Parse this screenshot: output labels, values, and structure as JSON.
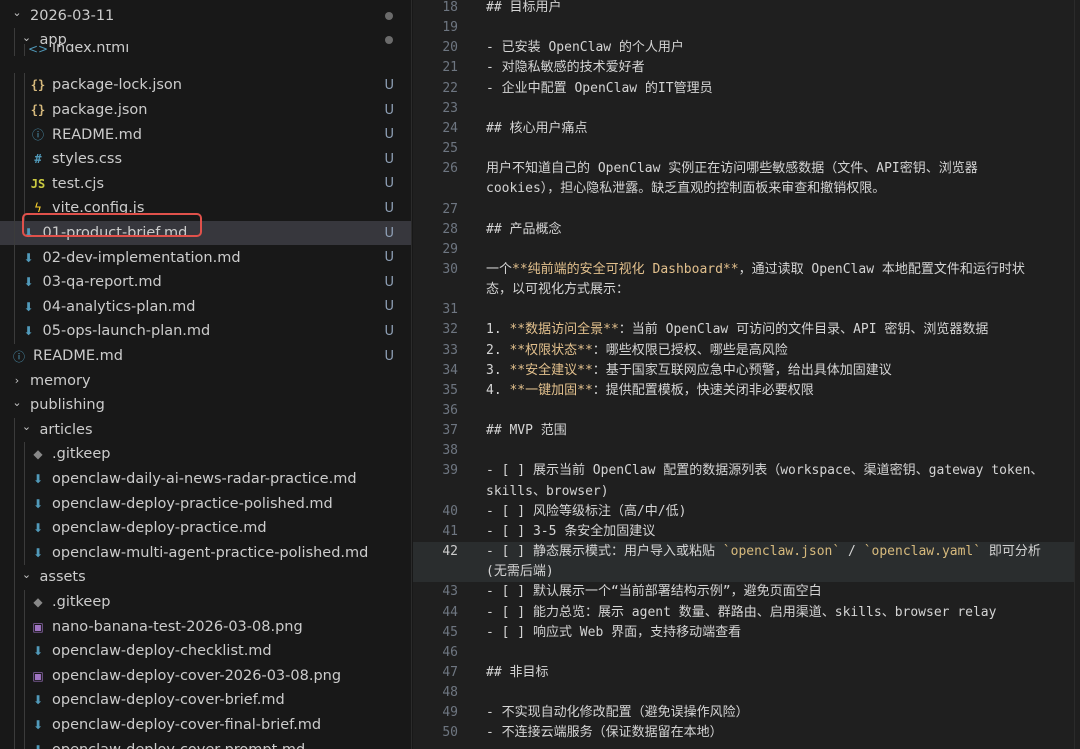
{
  "sidebar": {
    "rows": [
      {
        "label": "2026-03-11",
        "kind": "folder-open",
        "icon": "chevron-down-icon",
        "depth": 0,
        "status": "dot"
      },
      {
        "label": "app",
        "kind": "folder-open",
        "icon": "chevron-down-icon",
        "depth": 1,
        "status": "dot"
      },
      {
        "label": "index.html",
        "kind": "file",
        "icon": "html-icon",
        "depth": 2,
        "status": "",
        "partial": true
      },
      {
        "label": "package-lock.json",
        "kind": "file",
        "icon": "json-icon",
        "depth": 2,
        "status": "U"
      },
      {
        "label": "package.json",
        "kind": "file",
        "icon": "json-icon",
        "depth": 2,
        "status": "U"
      },
      {
        "label": "README.md",
        "kind": "file",
        "icon": "info-icon",
        "depth": 2,
        "status": "U"
      },
      {
        "label": "styles.css",
        "kind": "file",
        "icon": "css-icon",
        "depth": 2,
        "status": "U"
      },
      {
        "label": "test.cjs",
        "kind": "file",
        "icon": "js-icon",
        "depth": 2,
        "status": "U"
      },
      {
        "label": "vite.config.js",
        "kind": "file",
        "icon": "vite-icon",
        "depth": 2,
        "status": "U"
      },
      {
        "label": "01-product-brief.md",
        "kind": "file",
        "icon": "markdown-icon",
        "depth": 1,
        "status": "U",
        "selected": true
      },
      {
        "label": "02-dev-implementation.md",
        "kind": "file",
        "icon": "markdown-icon",
        "depth": 1,
        "status": "U"
      },
      {
        "label": "03-qa-report.md",
        "kind": "file",
        "icon": "markdown-icon",
        "depth": 1,
        "status": "U"
      },
      {
        "label": "04-analytics-plan.md",
        "kind": "file",
        "icon": "markdown-icon",
        "depth": 1,
        "status": "U"
      },
      {
        "label": "05-ops-launch-plan.md",
        "kind": "file",
        "icon": "markdown-icon",
        "depth": 1,
        "status": "U"
      },
      {
        "label": "README.md",
        "kind": "file",
        "icon": "info-icon",
        "depth": 0,
        "status": "U"
      },
      {
        "label": "memory",
        "kind": "folder-closed",
        "icon": "chevron-right-icon",
        "depth": 0,
        "status": ""
      },
      {
        "label": "publishing",
        "kind": "folder-open",
        "icon": "chevron-down-icon",
        "depth": 0,
        "status": ""
      },
      {
        "label": "articles",
        "kind": "folder-open",
        "icon": "chevron-down-icon",
        "depth": 1,
        "status": ""
      },
      {
        "label": ".gitkeep",
        "kind": "file",
        "icon": "gitkeep-icon",
        "depth": 2,
        "status": ""
      },
      {
        "label": "openclaw-daily-ai-news-radar-practice.md",
        "kind": "file",
        "icon": "markdown-icon",
        "depth": 2,
        "status": ""
      },
      {
        "label": "openclaw-deploy-practice-polished.md",
        "kind": "file",
        "icon": "markdown-icon",
        "depth": 2,
        "status": ""
      },
      {
        "label": "openclaw-deploy-practice.md",
        "kind": "file",
        "icon": "markdown-icon",
        "depth": 2,
        "status": ""
      },
      {
        "label": "openclaw-multi-agent-practice-polished.md",
        "kind": "file",
        "icon": "markdown-icon",
        "depth": 2,
        "status": ""
      },
      {
        "label": "assets",
        "kind": "folder-open",
        "icon": "chevron-down-icon",
        "depth": 1,
        "status": ""
      },
      {
        "label": ".gitkeep",
        "kind": "file",
        "icon": "gitkeep-icon",
        "depth": 2,
        "status": ""
      },
      {
        "label": "nano-banana-test-2026-03-08.png",
        "kind": "file",
        "icon": "image-icon",
        "depth": 2,
        "status": ""
      },
      {
        "label": "openclaw-deploy-checklist.md",
        "kind": "file",
        "icon": "markdown-icon",
        "depth": 2,
        "status": ""
      },
      {
        "label": "openclaw-deploy-cover-2026-03-08.png",
        "kind": "file",
        "icon": "image-icon",
        "depth": 2,
        "status": ""
      },
      {
        "label": "openclaw-deploy-cover-brief.md",
        "kind": "file",
        "icon": "markdown-icon",
        "depth": 2,
        "status": ""
      },
      {
        "label": "openclaw-deploy-cover-final-brief.md",
        "kind": "file",
        "icon": "markdown-icon",
        "depth": 2,
        "status": ""
      },
      {
        "label": "openclaw-deploy-cover-prompt.md",
        "kind": "file",
        "icon": "markdown-icon",
        "depth": 2,
        "status": ""
      }
    ]
  },
  "editor": {
    "active_line": "42",
    "lines": [
      {
        "n": "18",
        "text": "## 目标用户"
      },
      {
        "n": "19",
        "text": ""
      },
      {
        "n": "20",
        "text": "- 已安装 OpenClaw 的个人用户"
      },
      {
        "n": "21",
        "text": "- 对隐私敏感的技术爱好者"
      },
      {
        "n": "22",
        "text": "- 企业中配置 OpenClaw 的IT管理员"
      },
      {
        "n": "23",
        "text": ""
      },
      {
        "n": "24",
        "text": "## 核心用户痛点"
      },
      {
        "n": "25",
        "text": ""
      },
      {
        "n": "26",
        "text": "用户不知道自己的 OpenClaw 实例正在访问哪些敏感数据（文件、API密钥、浏览器"
      },
      {
        "n": "",
        "text": "cookies），担心隐私泄露。缺乏直观的控制面板来审查和撤销权限。"
      },
      {
        "n": "27",
        "text": ""
      },
      {
        "n": "28",
        "text": "## 产品概念"
      },
      {
        "n": "29",
        "text": ""
      },
      {
        "n": "30",
        "pre": "一个",
        "bold": "**纯前端的安全可视化 Dashboard**",
        "post": "，通过读取 OpenClaw 本地配置文件和运行时状"
      },
      {
        "n": "",
        "text": "态，以可视化方式展示："
      },
      {
        "n": "31",
        "text": ""
      },
      {
        "n": "32",
        "pre": "1. ",
        "bold": "**数据访问全景**",
        "post": "：当前 OpenClaw 可访问的文件目录、API 密钥、浏览器数据"
      },
      {
        "n": "33",
        "pre": "2. ",
        "bold": "**权限状态**",
        "post": "：哪些权限已授权、哪些是高风险"
      },
      {
        "n": "34",
        "pre": "3. ",
        "bold": "**安全建议**",
        "post": "：基于国家互联网应急中心预警，给出具体加固建议"
      },
      {
        "n": "35",
        "pre": "4. ",
        "bold": "**一键加固**",
        "post": "：提供配置模板，快速关闭非必要权限"
      },
      {
        "n": "36",
        "text": ""
      },
      {
        "n": "37",
        "text": "## MVP 范围"
      },
      {
        "n": "38",
        "text": ""
      },
      {
        "n": "39",
        "text": "- [ ] 展示当前 OpenClaw 配置的数据源列表（workspace、渠道密钥、gateway token、"
      },
      {
        "n": "",
        "text": "skills、browser)"
      },
      {
        "n": "40",
        "text": "- [ ] 风险等级标注（高/中/低)"
      },
      {
        "n": "41",
        "text": "- [ ] 3-5 条安全加固建议"
      },
      {
        "n": "42",
        "pre": "- [ ] 静态展示模式：用户导入或粘贴 ",
        "c1": "`openclaw.json`",
        "mid": " / ",
        "c2": "`openclaw.yaml`",
        "post": " 即可分析"
      },
      {
        "n": "",
        "text": "(无需后端)"
      },
      {
        "n": "43",
        "text": "- [ ] 默认展示一个“当前部署结构示例”，避免页面空白"
      },
      {
        "n": "44",
        "text": "- [ ] 能力总览：展示 agent 数量、群路由、启用渠道、skills、browser relay"
      },
      {
        "n": "45",
        "text": "- [ ] 响应式 Web 界面，支持移动端查看"
      },
      {
        "n": "46",
        "text": ""
      },
      {
        "n": "47",
        "text": "## 非目标"
      },
      {
        "n": "48",
        "text": ""
      },
      {
        "n": "49",
        "text": "- 不实现自动化修改配置（避免误操作风险）"
      },
      {
        "n": "50",
        "text": "- 不连接云端服务（保证数据留在本地）"
      }
    ]
  },
  "colors": {
    "sidebar_bg": "#181818",
    "editor_bg": "#1f1f1f",
    "selection_bg": "#37373d",
    "highlight_border": "#e0514b",
    "bold_text": "#e2c08d",
    "git_untracked": "#8fa0b6"
  }
}
